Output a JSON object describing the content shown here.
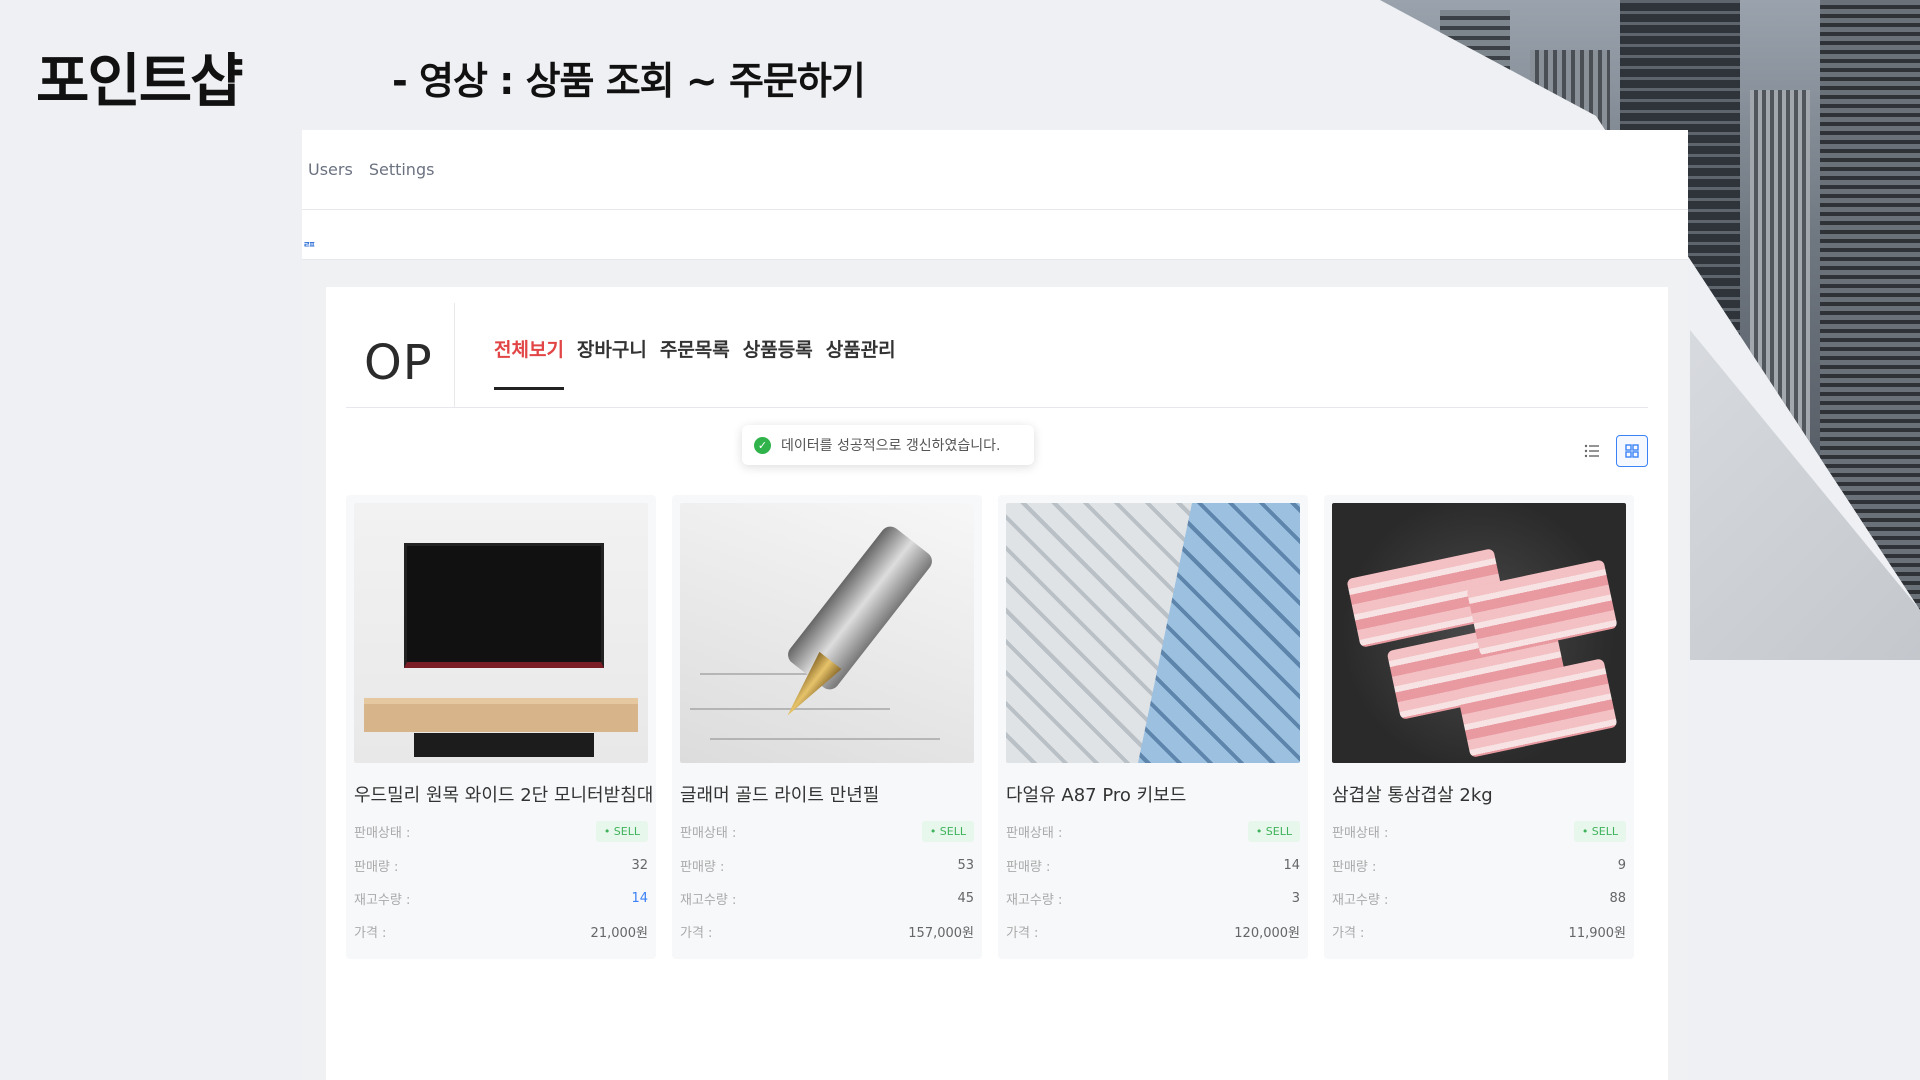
{
  "slide": {
    "title": "포인트샵",
    "subtitle": "- 영상 : 상품 조회 ~ 주문하기"
  },
  "app": {
    "topnav": [
      "Users",
      "Settings"
    ],
    "toast": "데이터를 성공적으로 갱신하였습니다.",
    "brand": "OP",
    "tabs": [
      "전체보기",
      "장바구니",
      "주문목록",
      "상품등록",
      "상품관리"
    ],
    "active_tab": "전체보기",
    "view_modes": [
      "list-icon",
      "grid-icon"
    ],
    "labels": {
      "status": "판매상태 :",
      "sold": "판매량 :",
      "stock": "재고수량 :",
      "price": "가격 :"
    },
    "products": [
      {
        "name": "우드밀리 원목 와이드 2단 모니터받침대",
        "status": "• SELL",
        "sold": "32",
        "stock": "14",
        "price": "21,000원",
        "image": "monitor-stand-image"
      },
      {
        "name": "글래머 골드 라이트 만년필",
        "status": "• SELL",
        "sold": "53",
        "stock": "45",
        "price": "157,000원",
        "image": "fountain-pen-image"
      },
      {
        "name": "다얼유 A87 Pro 키보드",
        "status": "• SELL",
        "sold": "14",
        "stock": "3",
        "price": "120,000원",
        "image": "keyboard-image"
      },
      {
        "name": "삼겹살 통삼겹살 2kg",
        "status": "• SELL",
        "sold": "9",
        "stock": "88",
        "price": "11,900원",
        "image": "pork-belly-image"
      }
    ],
    "colors": {
      "active_tab": "#e24545",
      "badge_green": "#3fb35c",
      "accent_blue": "#3b82f6"
    }
  }
}
